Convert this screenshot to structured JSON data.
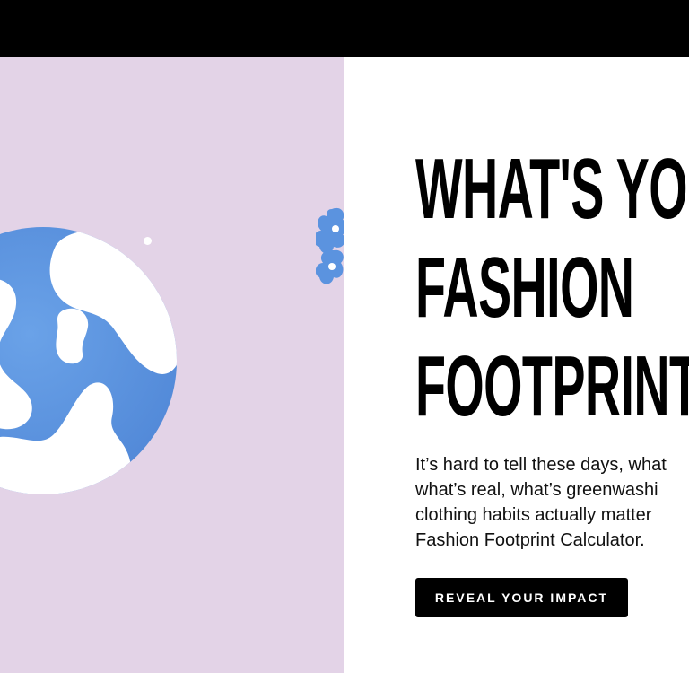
{
  "header": {},
  "hero": {
    "headline_lines": [
      "WHAT'S YOUR",
      "FASHION",
      "FOOTPRINT?"
    ],
    "description_lines": [
      "It’s hard to tell these days, what",
      "what’s real, what’s greenwashi",
      "clothing habits actually matter",
      "Fashion Footprint Calculator."
    ],
    "cta_label": "REVEAL YOUR IMPACT"
  },
  "colors": {
    "art_background": "#e3d3e7",
    "globe_blue": "#5b93df",
    "globe_white": "#ffffff",
    "topbar": "#000000"
  },
  "icons": [
    "globe-illustration",
    "flower-illustration"
  ]
}
